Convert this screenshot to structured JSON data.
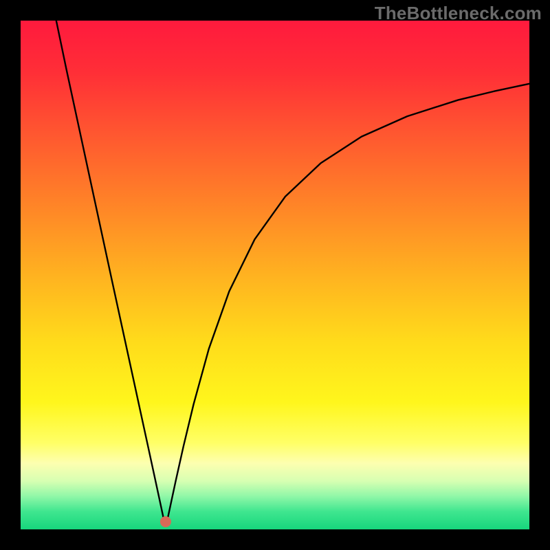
{
  "watermark": "TheBottleneck.com",
  "chart_data": {
    "type": "line",
    "title": "",
    "xlabel": "",
    "ylabel": "",
    "xlim": [
      0,
      100
    ],
    "ylim": [
      0,
      100
    ],
    "grid": false,
    "legend": false,
    "annotations": [],
    "background_gradient": [
      {
        "pos": 0.0,
        "color": "#ff1a3d"
      },
      {
        "pos": 0.1,
        "color": "#ff2e37"
      },
      {
        "pos": 0.22,
        "color": "#ff5630"
      },
      {
        "pos": 0.35,
        "color": "#ff8028"
      },
      {
        "pos": 0.5,
        "color": "#ffb220"
      },
      {
        "pos": 0.63,
        "color": "#ffdb1b"
      },
      {
        "pos": 0.75,
        "color": "#fff61c"
      },
      {
        "pos": 0.83,
        "color": "#ffff66"
      },
      {
        "pos": 0.87,
        "color": "#fdffb0"
      },
      {
        "pos": 0.905,
        "color": "#d7ffb2"
      },
      {
        "pos": 0.935,
        "color": "#90f7a8"
      },
      {
        "pos": 0.965,
        "color": "#3fe68f"
      },
      {
        "pos": 1.0,
        "color": "#17d67c"
      }
    ],
    "marker": {
      "x": 28.5,
      "y": 1.5,
      "color": "#d86a57",
      "radius": 8
    },
    "series": [
      {
        "name": "curve",
        "color": "#000000",
        "width": 2.4,
        "x": [
          7.0,
          9.0,
          12.0,
          15.0,
          18.0,
          21.0,
          23.5,
          25.0,
          26.3,
          27.4,
          28.0,
          28.2,
          28.5,
          28.8,
          29.0,
          29.6,
          30.5,
          32.0,
          34.0,
          37.0,
          41.0,
          46.0,
          52.0,
          59.0,
          67.0,
          76.0,
          86.0,
          93.0,
          100.0
        ],
        "y": [
          100.0,
          90.4,
          76.5,
          62.6,
          48.7,
          34.9,
          23.4,
          16.5,
          10.5,
          5.4,
          2.6,
          1.7,
          1.0,
          1.7,
          2.6,
          5.4,
          9.6,
          16.3,
          24.6,
          35.5,
          46.8,
          57.0,
          65.4,
          72.0,
          77.2,
          81.2,
          84.4,
          86.1,
          87.6
        ]
      }
    ]
  }
}
